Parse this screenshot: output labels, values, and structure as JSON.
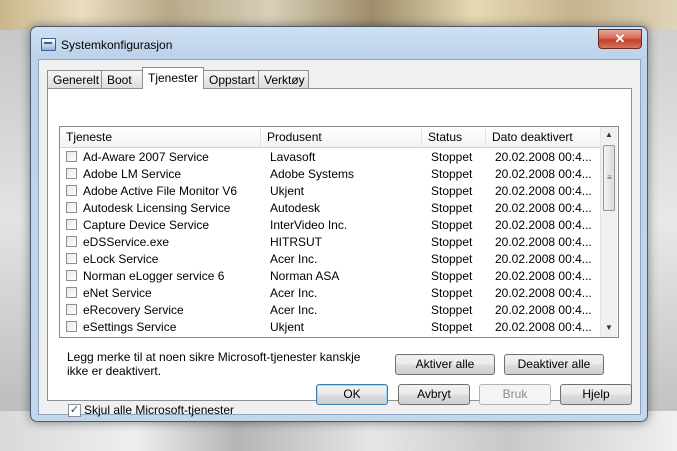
{
  "window": {
    "title": "Systemkonfigurasjon",
    "close_glyph": "✕",
    "app_icon": "msconfig-icon"
  },
  "tabs": [
    {
      "label": "Generelt",
      "active": false
    },
    {
      "label": "Boot",
      "active": false
    },
    {
      "label": "Tjenester",
      "active": true
    },
    {
      "label": "Oppstart",
      "active": false
    },
    {
      "label": "Verktøy",
      "active": false
    }
  ],
  "services": {
    "columns": [
      "Tjeneste",
      "Produsent",
      "Status",
      "Dato deaktivert"
    ],
    "rows": [
      {
        "checked": false,
        "name": "Ad-Aware 2007 Service",
        "manufacturer": "Lavasoft",
        "status": "Stoppet",
        "date": "20.02.2008 00:4..."
      },
      {
        "checked": false,
        "name": "Adobe LM Service",
        "manufacturer": "Adobe Systems",
        "status": "Stoppet",
        "date": "20.02.2008 00:4..."
      },
      {
        "checked": false,
        "name": "Adobe Active File Monitor V6",
        "manufacturer": "Ukjent",
        "status": "Stoppet",
        "date": "20.02.2008 00:4..."
      },
      {
        "checked": false,
        "name": "Autodesk Licensing Service",
        "manufacturer": "Autodesk",
        "status": "Stoppet",
        "date": "20.02.2008 00:4..."
      },
      {
        "checked": false,
        "name": "Capture Device Service",
        "manufacturer": "InterVideo Inc.",
        "status": "Stoppet",
        "date": "20.02.2008 00:4..."
      },
      {
        "checked": false,
        "name": "eDSService.exe",
        "manufacturer": "HITRSUT",
        "status": "Stoppet",
        "date": "20.02.2008 00:4..."
      },
      {
        "checked": false,
        "name": "eLock Service",
        "manufacturer": "Acer Inc.",
        "status": "Stoppet",
        "date": "20.02.2008 00:4..."
      },
      {
        "checked": false,
        "name": "Norman eLogger service 6",
        "manufacturer": "Norman ASA",
        "status": "Stoppet",
        "date": "20.02.2008 00:4..."
      },
      {
        "checked": false,
        "name": "eNet Service",
        "manufacturer": "Acer Inc.",
        "status": "Stoppet",
        "date": "20.02.2008 00:4..."
      },
      {
        "checked": false,
        "name": "eRecovery Service",
        "manufacturer": "Acer Inc.",
        "status": "Stoppet",
        "date": "20.02.2008 00:4..."
      },
      {
        "checked": false,
        "name": "eSettings Service",
        "manufacturer": "Ukjent",
        "status": "Stoppet",
        "date": "20.02.2008 00:4..."
      }
    ]
  },
  "info_text": "Legg merke til at noen sikre Microsoft-tjenester kanskje ikke er deaktivert.",
  "buttons": {
    "enable_all": "Aktiver alle",
    "disable_all": "Deaktiver alle",
    "ok": "OK",
    "cancel": "Avbryt",
    "apply": "Bruk",
    "help": "Hjelp"
  },
  "hide_ms": {
    "label": "Skjul alle Microsoft-tjenester",
    "checked": true,
    "check_glyph": "✓"
  },
  "scroll": {
    "up_glyph": "▲",
    "down_glyph": "▼",
    "grip_glyph": "≡"
  }
}
